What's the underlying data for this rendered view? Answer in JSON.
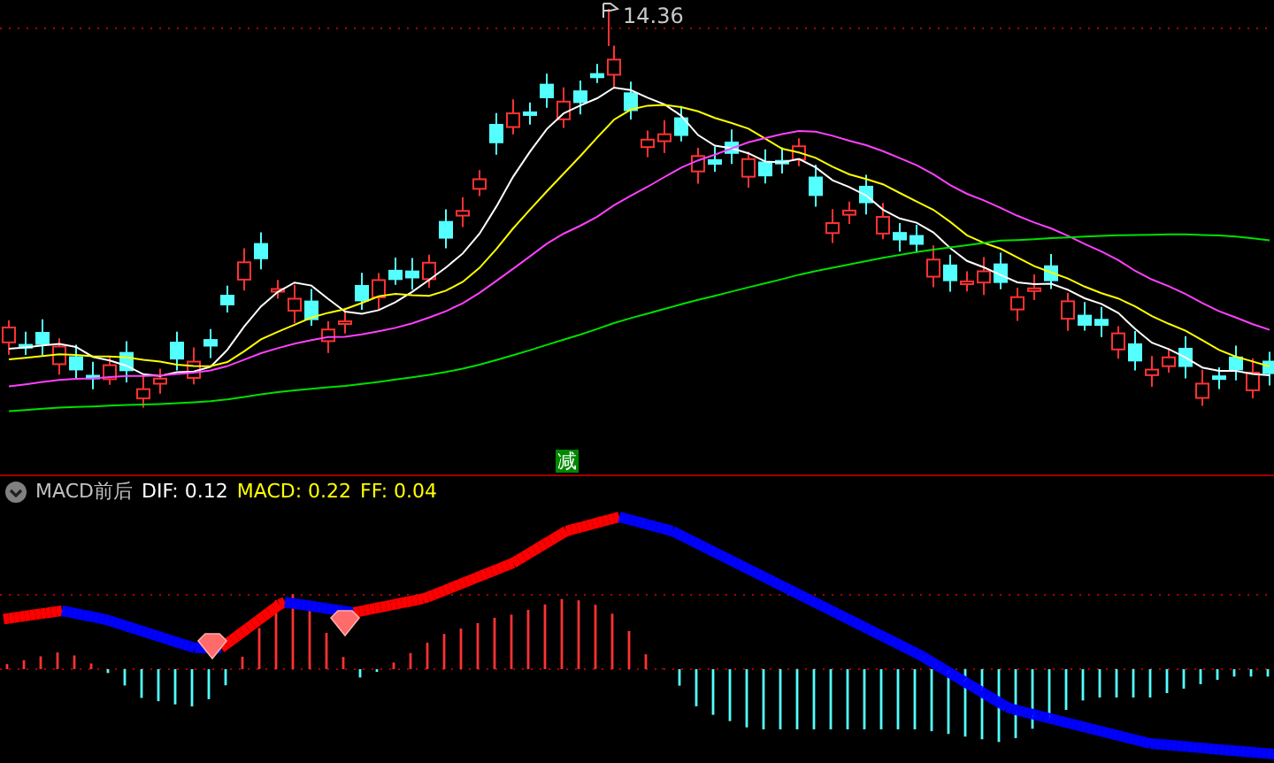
{
  "price_panel": {
    "high_label": "14.36",
    "signal_badge": "减"
  },
  "indicator_header": {
    "name": "MACD前后",
    "collapsed": false,
    "values": [
      {
        "label": "DIF: 0.12",
        "color": "#ffffff"
      },
      {
        "label": "MACD: 0.22",
        "color": "#ffff00"
      },
      {
        "label": "FF: 0.04",
        "color": "#ffff00"
      }
    ]
  }
}
